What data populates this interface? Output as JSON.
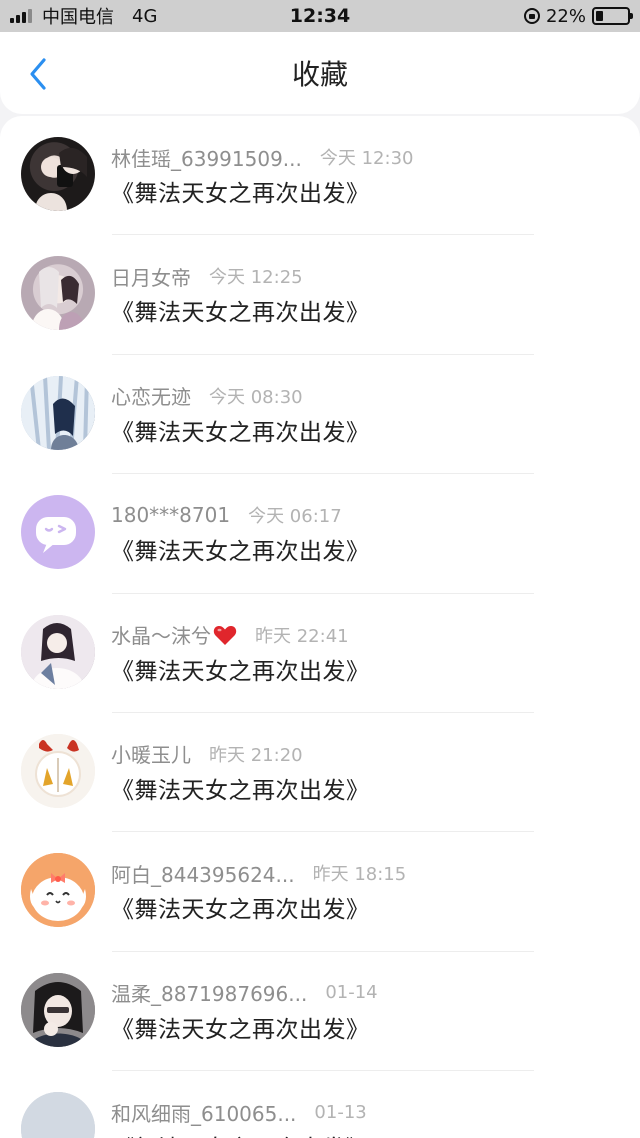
{
  "status_bar": {
    "carrier": "中国电信",
    "network": "4G",
    "time": "12:34",
    "battery": "22%",
    "battery_level": 0.22
  },
  "nav": {
    "back_icon": "chevron-left-icon",
    "title": "收藏"
  },
  "colors": {
    "accent": "#2b8ff0",
    "heart": "#e0262c"
  },
  "items": [
    {
      "username": "林佳瑶_63991509...",
      "time": "今天 12:30",
      "title": "《舞法天女之再次出发》"
    },
    {
      "username": "日月女帝",
      "time": "今天 12:25",
      "title": "《舞法天女之再次出发》"
    },
    {
      "username": "心恋无迹",
      "time": "今天 08:30",
      "title": "《舞法天女之再次出发》"
    },
    {
      "username": "180***8701",
      "time": "今天 06:17",
      "title": "《舞法天女之再次出发》"
    },
    {
      "username": "水晶～沫兮",
      "time": "昨天 22:41",
      "title": "《舞法天女之再次出发》",
      "emoji": "heart-icon"
    },
    {
      "username": "小暖玉儿",
      "time": "昨天 21:20",
      "title": "《舞法天女之再次出发》"
    },
    {
      "username": "阿白_844395624...",
      "time": "昨天 18:15",
      "title": "《舞法天女之再次出发》"
    },
    {
      "username": "温柔_8871987696...",
      "time": "01-14",
      "title": "《舞法天女之再次出发》"
    },
    {
      "username": "和风细雨_610065...",
      "time": "01-13",
      "title": "《舞法天女之再次出发》"
    }
  ]
}
